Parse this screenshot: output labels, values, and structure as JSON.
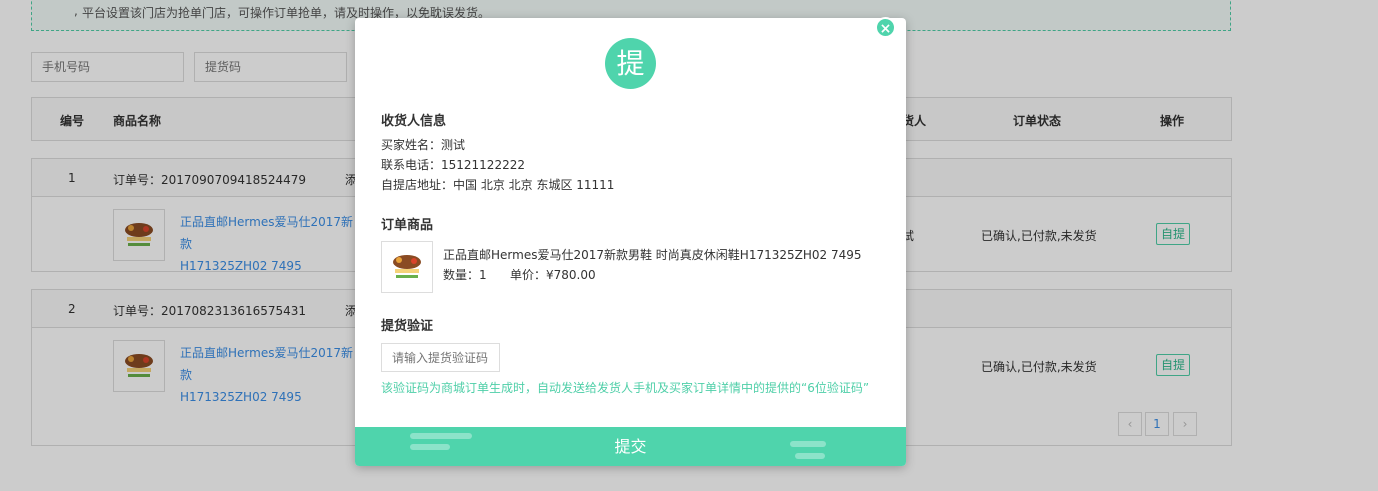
{
  "notice": {
    "text": "平台设置该门店为抢单门店，可操作订单抢单，请及时操作，以免耽误发货。",
    "bullet": ","
  },
  "search": {
    "phone_placeholder": "手机号码",
    "pickup_code_placeholder": "提货码"
  },
  "table": {
    "headers": [
      "编号",
      "商品名称",
      "收货人",
      "订单状态",
      "操作"
    ],
    "header_contact_visible": "货人"
  },
  "orders": [
    {
      "index": "1",
      "order_no": "订单号：2017090709418524479",
      "added_prefix": "添",
      "product_line1": "正品直邮Hermes爱马仕2017新款",
      "product_line2": "H171325ZH02 7495",
      "contact": "试",
      "status": "已确认,已付款,未发货",
      "action": "自提"
    },
    {
      "index": "2",
      "order_no": "订单号：2017082313616575431",
      "added_prefix": "添",
      "product_line1": "正品直邮Hermes爱马仕2017新款",
      "product_line2": "H171325ZH02 7495",
      "contact": "",
      "status": "已确认,已付款,未发货",
      "action": "自提"
    }
  ],
  "pager": {
    "prev": "‹",
    "current": "1",
    "next": "›"
  },
  "modal": {
    "icon_text": "提",
    "close": "×",
    "receiver_title": "收货人信息",
    "buyer_name": "买家姓名：测试",
    "phone": "联系电话：15121122222",
    "address": "自提店地址：中国 北京 北京 东城区 11111",
    "goods_title": "订单商品",
    "product_name": "正品直邮Hermes爱马仕2017新款男鞋 时尚真皮休闲鞋H171325ZH02 7495",
    "qty": "数量：1",
    "price": "单价：¥780.00",
    "verify_title": "提货验证",
    "verify_placeholder": "请输入提货验证码",
    "hint": "该验证码为商城订单生成时，自动发送给发货人手机及买家订单详情中的提供的“6位验证码”",
    "submit": "提交"
  },
  "colors": {
    "accent": "#4fd4ac",
    "link": "#3a8ee6",
    "overlay": "rgba(0,0,0,0.2)"
  },
  "icons": [
    "close-icon",
    "pick-icon",
    "product-thumbnail",
    "chevron-left-icon",
    "chevron-right-icon"
  ]
}
